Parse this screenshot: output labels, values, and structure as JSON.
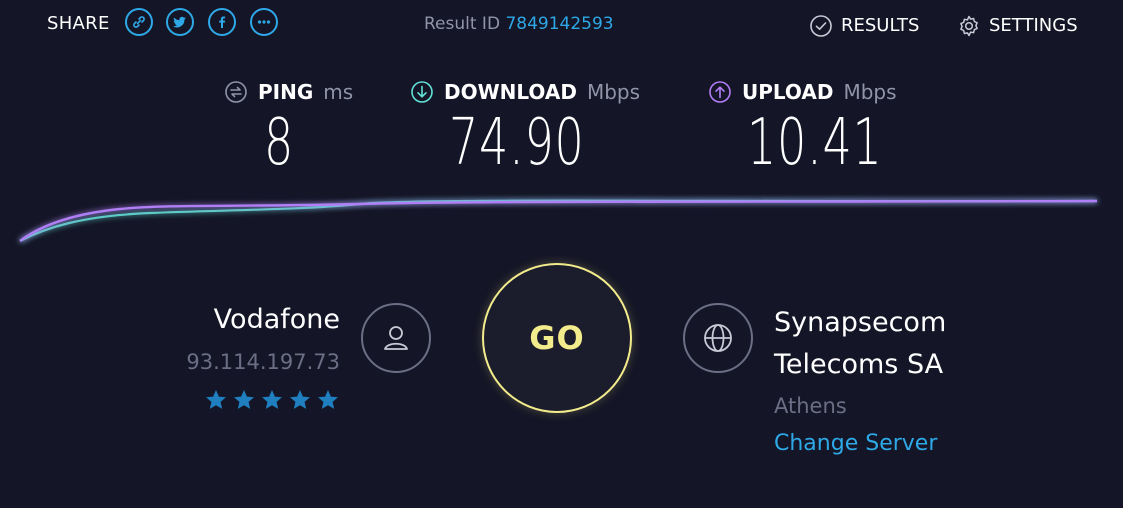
{
  "header": {
    "share_label": "SHARE",
    "share_buttons": [
      "link-icon",
      "twitter-icon",
      "facebook-icon",
      "more-icon"
    ],
    "result_id_label": "Result ID",
    "result_id": "7849142593",
    "results_label": "RESULTS",
    "settings_label": "SETTINGS"
  },
  "metrics": {
    "ping": {
      "label": "PING",
      "unit": "ms",
      "value": "8"
    },
    "download": {
      "label": "DOWNLOAD",
      "unit": "Mbps",
      "value": "74.90"
    },
    "upload": {
      "label": "UPLOAD",
      "unit": "Mbps",
      "value": "10.41"
    }
  },
  "colors": {
    "background": "#141526",
    "accent_blue": "#2ea8e6",
    "download_cyan": "#62e1d6",
    "upload_purple": "#b07ff5",
    "go_yellow": "#f3ec8c",
    "muted": "#6b6e85"
  },
  "isp": {
    "name": "Vodafone",
    "ip": "93.114.197.73",
    "rating_stars": 5
  },
  "go_label": "GO",
  "server": {
    "name_line1": "Synapsecom",
    "name_line2": "Telecoms SA",
    "city": "Athens",
    "change_label": "Change Server"
  }
}
